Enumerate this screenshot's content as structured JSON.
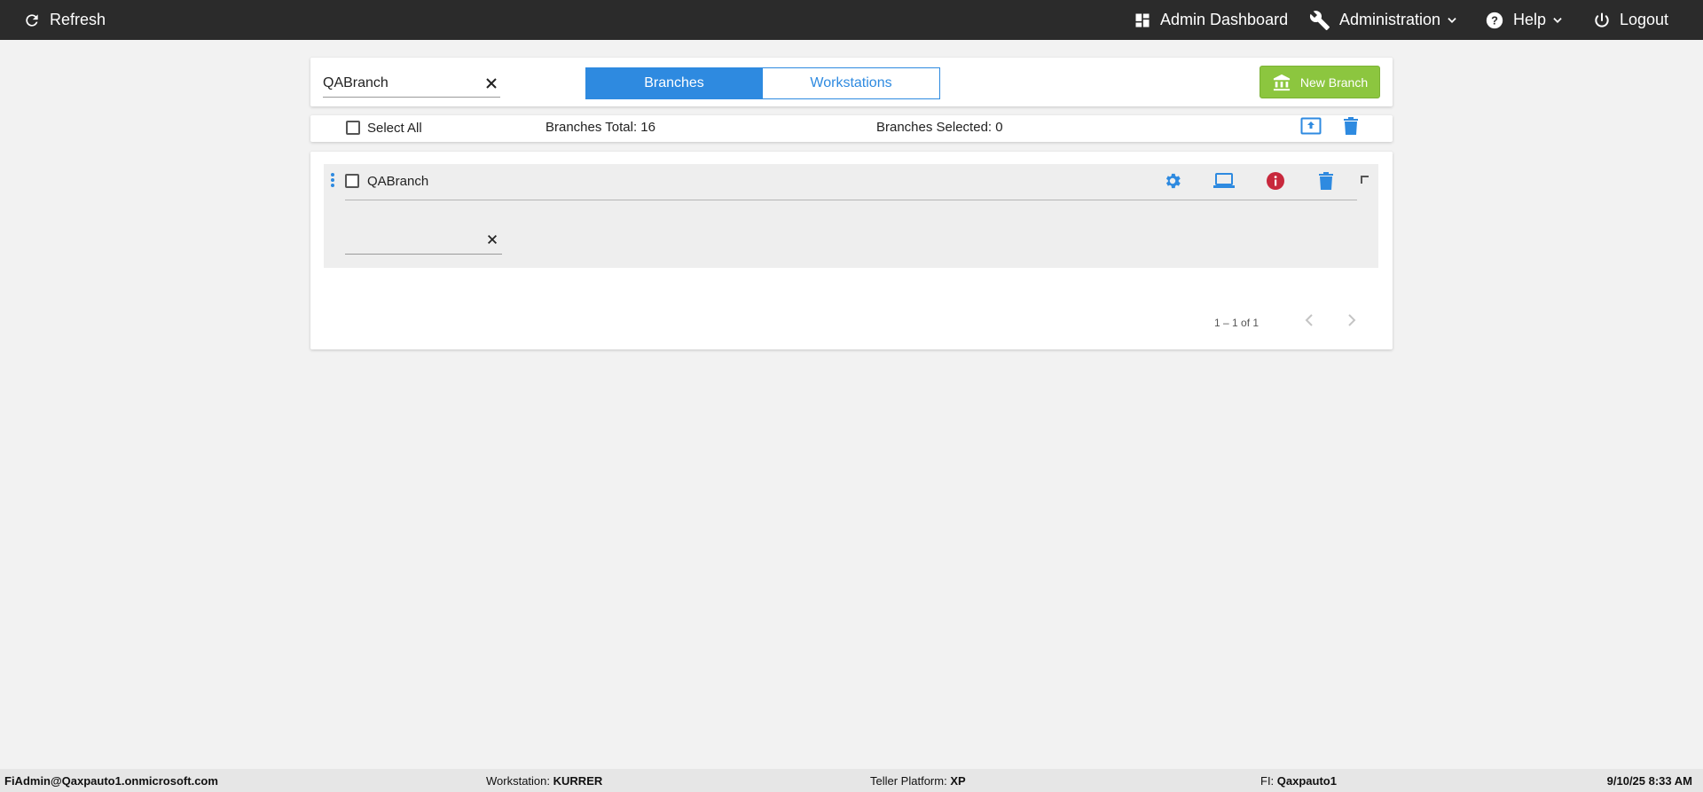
{
  "topbar": {
    "refresh_label": "Refresh",
    "admin_dashboard_label": "Admin Dashboard",
    "administration_label": "Administration",
    "help_label": "Help",
    "logout_label": "Logout"
  },
  "toolbar": {
    "search_value": "QABranch",
    "tabs": [
      {
        "label": "Branches",
        "active": true
      },
      {
        "label": "Workstations",
        "active": false
      }
    ],
    "new_branch_label": "New Branch"
  },
  "summary": {
    "select_all_label": "Select All",
    "branches_total_label": "Branches Total: 16",
    "branches_selected_label": "Branches Selected: 0"
  },
  "branch_list": {
    "rows": [
      {
        "name": "QABranch",
        "checked": false
      }
    ],
    "filter_value": "",
    "pagination_label": "1 – 1 of 1"
  },
  "statusbar": {
    "user": "FiAdmin@Qaxpauto1.onmicrosoft.com",
    "workstation_label": "Workstation:",
    "workstation_value": "KURRER",
    "teller_label": "Teller Platform:",
    "teller_value": "XP",
    "fi_label": "FI:",
    "fi_value": "Qaxpauto1",
    "datetime": "9/10/25 8:33 AM"
  },
  "colors": {
    "topbar_bg": "#2b2b2b",
    "accent_blue": "#2e8ae0",
    "new_button_green": "#8cc63f",
    "info_red": "#c8283c",
    "page_bg": "#f2f2f2"
  }
}
